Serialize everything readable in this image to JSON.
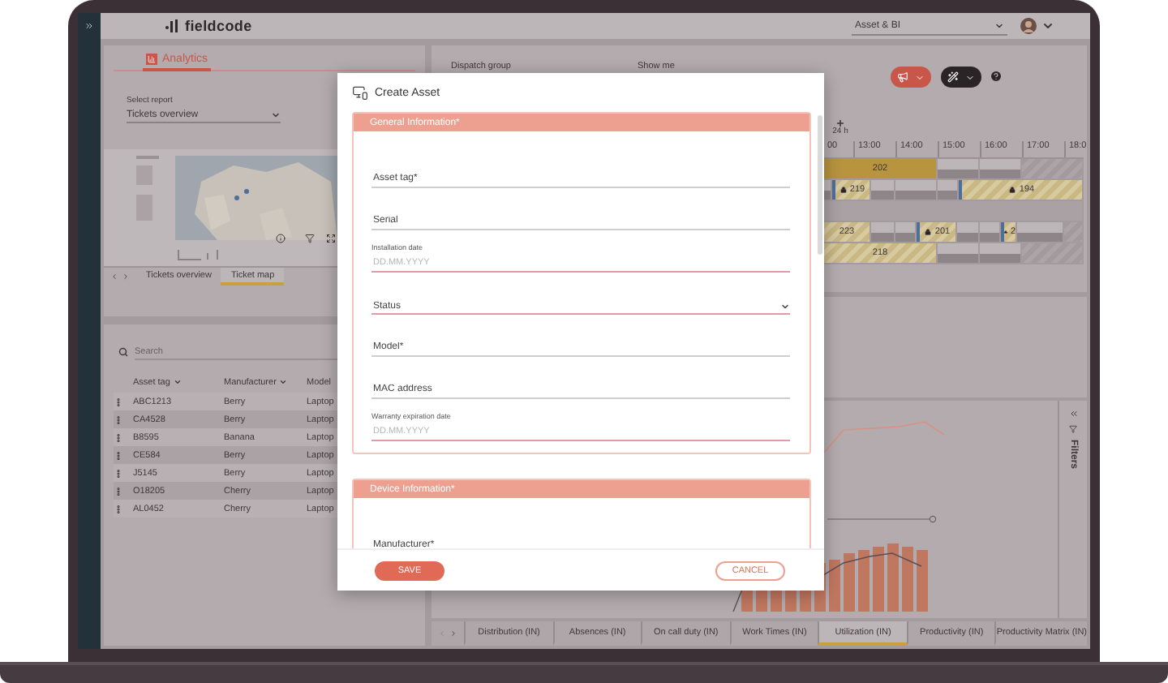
{
  "topbar": {
    "logo": "fieldcode",
    "workspace": "Asset & BI"
  },
  "analytics": {
    "tab": "Analytics",
    "report_label": "Select report",
    "report_value": "Tickets overview",
    "map_tabs": [
      {
        "label": "Tickets overview",
        "selected": false
      },
      {
        "label": "Ticket map",
        "selected": true
      }
    ]
  },
  "assets": {
    "search_placeholder": "Search",
    "columns": [
      {
        "label": "Asset tag",
        "sortable": true
      },
      {
        "label": "Manufacturer",
        "sortable": true
      },
      {
        "label": "Model",
        "sortable": false
      }
    ],
    "rows": [
      [
        "ABC1213",
        "Berry",
        "Laptop"
      ],
      [
        "CA4528",
        "Berry",
        "Laptop"
      ],
      [
        "B8595",
        "Banana",
        "Laptop"
      ],
      [
        "CE584",
        "Berry",
        "Laptop"
      ],
      [
        "J5145",
        "Berry",
        "Laptop"
      ],
      [
        "O18205",
        "Cherry",
        "Laptop"
      ],
      [
        "AL0452",
        "Cherry",
        "Laptop"
      ]
    ]
  },
  "dispatch": {
    "labels": [
      "Dispatch group",
      "Show me"
    ],
    "zoom_label": "24 h",
    "hours": [
      "00",
      "13:00",
      "14:00",
      "15:00",
      "16:00",
      "17:00",
      "18:0"
    ],
    "rows": [
      {
        "segments": [
          {
            "kind": "booked",
            "label": "202"
          },
          {
            "kind": "free"
          },
          {
            "kind": "free"
          },
          {
            "kind": "blocked"
          }
        ]
      },
      {
        "segments": [
          {
            "kind": "free"
          },
          {
            "kind": "pinned",
            "label": "219"
          },
          {
            "kind": "free"
          },
          {
            "kind": "free"
          },
          {
            "kind": "free"
          },
          {
            "kind": "pinned",
            "label": "194"
          }
        ]
      },
      {
        "segments": [
          {
            "kind": "empty"
          }
        ]
      },
      {
        "segments": [
          {
            "kind": "hatched",
            "label": "223"
          },
          {
            "kind": "free"
          },
          {
            "kind": "free"
          },
          {
            "kind": "pinned",
            "label": "201"
          },
          {
            "kind": "free"
          },
          {
            "kind": "free"
          },
          {
            "kind": "pinned",
            "label": "2"
          },
          {
            "kind": "free"
          },
          {
            "kind": "blocked"
          }
        ]
      },
      {
        "segments": [
          {
            "kind": "hatched",
            "label": "218"
          },
          {
            "kind": "free"
          },
          {
            "kind": "free"
          },
          {
            "kind": "blocked"
          }
        ]
      }
    ]
  },
  "filters": {
    "label": "Filters"
  },
  "report_tabs": [
    {
      "label": "Distribution (IN)",
      "selected": false
    },
    {
      "label": "Absences (IN)",
      "selected": false
    },
    {
      "label": "On call duty (IN)",
      "selected": false
    },
    {
      "label": "Work Times (IN)",
      "selected": false
    },
    {
      "label": "Utilization (IN)",
      "selected": true
    },
    {
      "label": "Productivity (IN)",
      "selected": false
    },
    {
      "label": "Productivity Matrix (IN)",
      "selected": false
    }
  ],
  "modal": {
    "title": "Create Asset",
    "sections": [
      {
        "title": "General Information*",
        "fields": [
          {
            "kind": "text",
            "placeholder": "Asset tag*",
            "invalid": false
          },
          {
            "kind": "text",
            "placeholder": "Serial",
            "invalid": false
          },
          {
            "kind": "date",
            "label": "Installation date",
            "placeholder": "DD.MM.YYYY",
            "invalid": true
          },
          {
            "kind": "select",
            "placeholder": "Status",
            "invalid": true
          },
          {
            "kind": "text",
            "placeholder": "Model*",
            "invalid": false
          },
          {
            "kind": "text",
            "placeholder": "MAC address",
            "invalid": false
          },
          {
            "kind": "date",
            "label": "Warranty expiration date",
            "placeholder": "DD.MM.YYYY",
            "invalid": true
          }
        ]
      },
      {
        "title": "Device Information*",
        "fields": [
          {
            "kind": "text",
            "placeholder": "Manufacturer*"
          }
        ]
      }
    ],
    "save": "SAVE",
    "cancel": "CANCEL"
  }
}
